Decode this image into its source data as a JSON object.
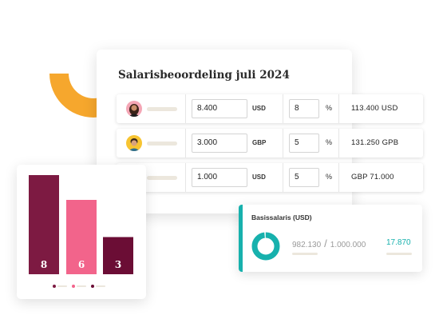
{
  "review": {
    "title": "Salarisbeoordeling juli 2024",
    "rows": [
      {
        "amount": "8.400",
        "currency": "USD",
        "percent": "8",
        "percent_sign": "%",
        "total": "113.400 USD"
      },
      {
        "amount": "3.000",
        "currency": "GBP",
        "percent": "5",
        "percent_sign": "%",
        "total": "131.250 GPB"
      },
      {
        "amount": "1.000",
        "currency": "USD",
        "percent": "5",
        "percent_sign": "%",
        "total": "GBP 71.000"
      }
    ]
  },
  "chart_data": {
    "type": "bar",
    "categories": [
      "",
      "",
      ""
    ],
    "values": [
      8,
      6,
      3
    ],
    "colors": [
      "#7d1a42",
      "#f2648b",
      "#6b0d35"
    ],
    "ylim": [
      0,
      8
    ]
  },
  "base_salary": {
    "title": "Basissalaris (USD)",
    "current": "982.130",
    "separator": "/",
    "target": "1.000.000",
    "difference": "17.870",
    "fill_fraction": 0.98
  },
  "colors": {
    "accent_orange": "#f6a72d",
    "accent_teal": "#17b1ad"
  }
}
